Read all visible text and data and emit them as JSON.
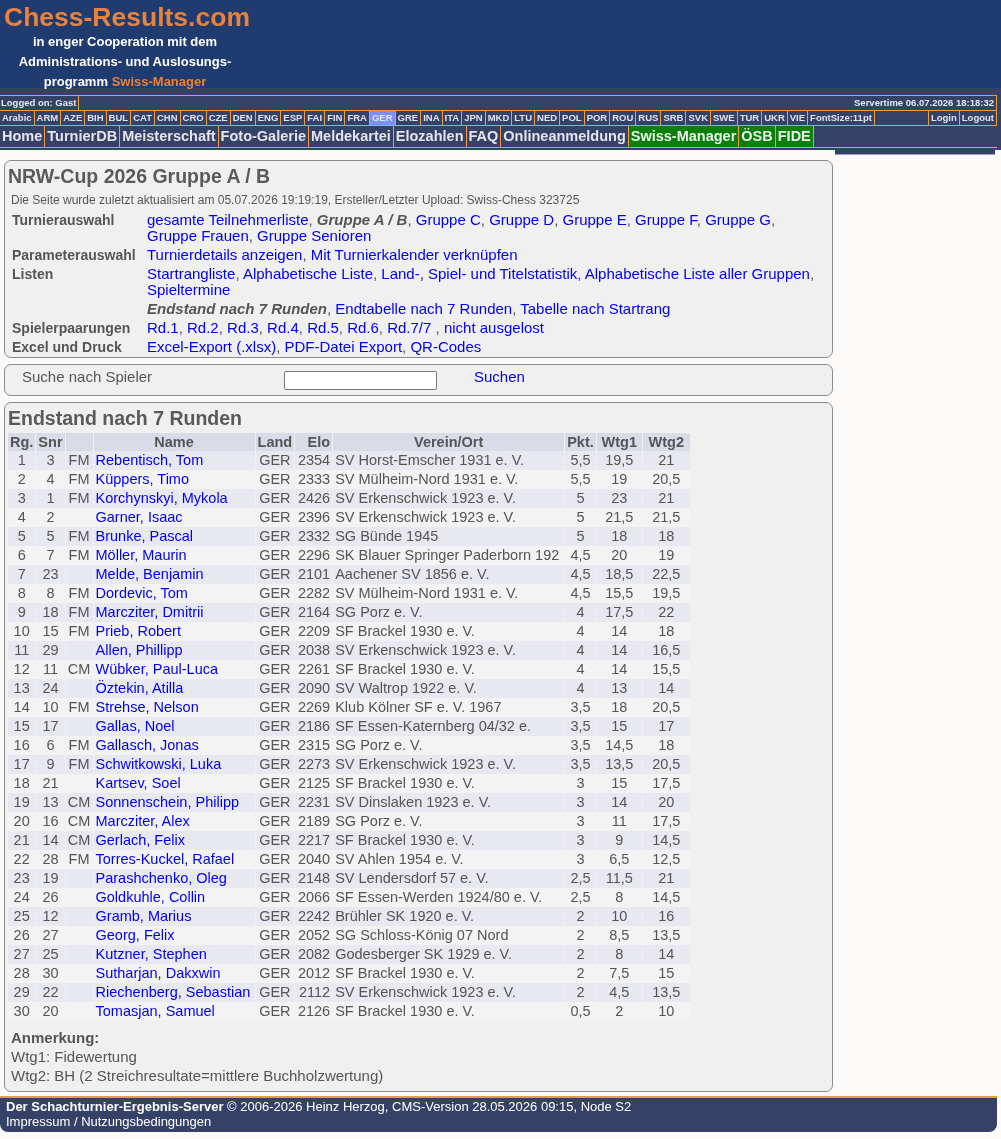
{
  "header": {
    "logo_title": "Chess-Results.com",
    "logo_tagline": [
      "in enger Cooperation mit dem",
      "Administrations- und Auslosungs-",
      "programm"
    ],
    "logo_product": "Swiss-Manager"
  },
  "status_bar": {
    "user": "Logged on: Gast",
    "servertime": "Servertime 06.07.2026 18:18:32"
  },
  "languages": [
    {
      "label": "Arabic",
      "selected": false
    },
    {
      "label": "ARM",
      "selected": false
    },
    {
      "label": "AZE",
      "selected": false
    },
    {
      "label": "BIH",
      "selected": false
    },
    {
      "label": "BUL",
      "selected": false
    },
    {
      "label": "CAT",
      "selected": false
    },
    {
      "label": "CHN",
      "selected": false
    },
    {
      "label": "CRO",
      "selected": false
    },
    {
      "label": "CZE",
      "selected": false
    },
    {
      "label": "DEN",
      "selected": false
    },
    {
      "label": "ENG",
      "selected": false
    },
    {
      "label": "ESP",
      "selected": false
    },
    {
      "label": "FAI",
      "selected": false
    },
    {
      "label": "FIN",
      "selected": false
    },
    {
      "label": "FRA",
      "selected": false
    },
    {
      "label": "GER",
      "selected": true
    },
    {
      "label": "GRE",
      "selected": false
    },
    {
      "label": "INA",
      "selected": false
    },
    {
      "label": "ITA",
      "selected": false
    },
    {
      "label": "JPN",
      "selected": false
    },
    {
      "label": "MKD",
      "selected": false
    },
    {
      "label": "LTU",
      "selected": false
    },
    {
      "label": "NED",
      "selected": false
    },
    {
      "label": "POL",
      "selected": false
    },
    {
      "label": "POR",
      "selected": false
    },
    {
      "label": "ROU",
      "selected": false
    },
    {
      "label": "RUS",
      "selected": false
    },
    {
      "label": "SRB",
      "selected": false
    },
    {
      "label": "SVK",
      "selected": false
    },
    {
      "label": "SWE",
      "selected": false
    },
    {
      "label": "TUR",
      "selected": false
    },
    {
      "label": "UKR",
      "selected": false
    },
    {
      "label": "VIE",
      "selected": false
    }
  ],
  "font_size": "FontSize:11pt",
  "account_links": [
    "Login",
    "Logout"
  ],
  "menu": [
    {
      "label": "Home",
      "kind": "standard"
    },
    {
      "label": "TurnierDB",
      "kind": "standard"
    },
    {
      "label": "Meisterschaft",
      "kind": "standard"
    },
    {
      "label": "Foto-Galerie",
      "kind": "standard"
    },
    {
      "label": "Meldekartei",
      "kind": "standard"
    },
    {
      "label": "Elozahlen",
      "kind": "standard"
    },
    {
      "label": "FAQ",
      "kind": "standard"
    },
    {
      "label": "Onlineanmeldung",
      "kind": "standard"
    },
    {
      "label": "Swiss-Manager",
      "kind": "partner"
    },
    {
      "label": "ÖSB",
      "kind": "partner"
    },
    {
      "label": "FIDE",
      "kind": "partner"
    }
  ],
  "tournament": {
    "title": "NRW-Cup 2026 Gruppe A / B",
    "updated": "Die Seite wurde zuletzt aktualisiert am 05.07.2026 19:19:19, Ersteller/Letzter Upload: Swiss-Chess 323725",
    "rows": [
      {
        "label": "Turnierauswahl",
        "items": [
          {
            "text": "gesamte Teilnehmerliste",
            "kind": "link",
            "after": ", "
          },
          {
            "text": "Gruppe A / B",
            "kind": "current",
            "after": ", "
          },
          {
            "text": "Gruppe C",
            "kind": "link",
            "after": ", "
          },
          {
            "text": "Gruppe D",
            "kind": "link",
            "after": ", "
          },
          {
            "text": "Gruppe E",
            "kind": "link",
            "after": ", "
          },
          {
            "text": "Gruppe F",
            "kind": "link",
            "after": ", "
          },
          {
            "text": "Gruppe G",
            "kind": "link",
            "after": ", "
          },
          {
            "text": "Gruppe Frauen",
            "kind": "link",
            "after": ", "
          },
          {
            "text": "Gruppe Senioren",
            "kind": "link"
          }
        ]
      },
      {
        "label": "Parameterauswahl",
        "items": [
          {
            "text": "Turnierdetails anzeigen",
            "kind": "link",
            "after": ", "
          },
          {
            "text": "Mit Turnierkalender verknüpfen",
            "kind": "link"
          }
        ]
      },
      {
        "label": "Listen",
        "items": [
          {
            "text": "Startrangliste",
            "kind": "link",
            "after": ", "
          },
          {
            "text": "Alphabetische Liste",
            "kind": "link",
            "after": ", "
          },
          {
            "text": "Land-, Spiel- und Titelstatistik",
            "kind": "link",
            "after": ", "
          },
          {
            "text": "Alphabetische Liste aller Gruppen",
            "kind": "link",
            "after": ", "
          },
          {
            "text": "Spieltermine",
            "kind": "link"
          }
        ]
      },
      {
        "items": [
          {
            "text": "Endstand nach 7 Runden",
            "kind": "current",
            "after": ", "
          },
          {
            "text": "Endtabelle nach 7 Runden",
            "kind": "link",
            "after": ", "
          },
          {
            "text": "Tabelle nach Startrang",
            "kind": "link"
          }
        ]
      },
      {
        "label": "Spielerpaarungen",
        "items": [
          {
            "text": "Rd.1",
            "kind": "link",
            "after": ", "
          },
          {
            "text": "Rd.2",
            "kind": "link",
            "after": ", "
          },
          {
            "text": "Rd.3",
            "kind": "link",
            "after": ", "
          },
          {
            "text": "Rd.4",
            "kind": "link",
            "after": ", "
          },
          {
            "text": "Rd.5",
            "kind": "link",
            "after": ", "
          },
          {
            "text": "Rd.6",
            "kind": "link",
            "after": ", "
          },
          {
            "text": "Rd.7/7",
            "kind": "link",
            "after": " , "
          },
          {
            "text": "nicht ausgelost",
            "kind": "link"
          }
        ]
      },
      {
        "label": "Excel und Druck",
        "items": [
          {
            "text": "Excel-Export (.xlsx)",
            "kind": "link",
            "after": ", "
          },
          {
            "text": "PDF-Datei Export",
            "kind": "link",
            "after": ", "
          },
          {
            "text": "QR-Codes",
            "kind": "link"
          }
        ]
      }
    ]
  },
  "search": {
    "label": "Suche nach Spieler",
    "button": "Suchen"
  },
  "standings": {
    "title": "Endstand nach 7 Runden",
    "columns": [
      {
        "label": "Rg.",
        "kind": "text"
      },
      {
        "label": "Snr",
        "kind": "text"
      },
      {
        "kind": "text"
      },
      {
        "label": "Name",
        "kind": "link"
      },
      {
        "label": "Land",
        "kind": "text"
      },
      {
        "label": "Elo",
        "kind": "text"
      },
      {
        "label": "Verein/Ort",
        "kind": "text"
      },
      {
        "label": "Pkt.",
        "kind": "text"
      },
      {
        "label": "Wtg1",
        "kind": "text"
      },
      {
        "label": "Wtg2",
        "kind": "text"
      }
    ],
    "rows": [
      [
        "1",
        "3",
        "FM",
        "Rebentisch, Tom",
        "GER",
        "2354",
        "SV Horst-Emscher 1931 e. V.",
        "5,5",
        "19,5",
        "21"
      ],
      [
        "2",
        "4",
        "FM",
        "Küppers, Timo",
        "GER",
        "2333",
        "SV Mülheim-Nord 1931 e. V.",
        "5,5",
        "19",
        "20,5"
      ],
      [
        "3",
        "1",
        "FM",
        "Korchynskyi, Mykola",
        "GER",
        "2426",
        "SV Erkenschwick 1923 e. V.",
        "5",
        "23",
        "21"
      ],
      [
        "4",
        "2",
        null,
        "Garner, Isaac",
        "GER",
        "2396",
        "SV Erkenschwick 1923 e. V.",
        "5",
        "21,5",
        "21,5"
      ],
      [
        "5",
        "5",
        "FM",
        "Brunke, Pascal",
        "GER",
        "2332",
        "SG Bünde 1945",
        "5",
        "18",
        "18"
      ],
      [
        "6",
        "7",
        "FM",
        "Möller, Maurin",
        "GER",
        "2296",
        "SK Blauer Springer Paderborn 192",
        "4,5",
        "20",
        "19"
      ],
      [
        "7",
        "23",
        null,
        "Melde, Benjamin",
        "GER",
        "2101",
        "Aachener SV 1856 e. V.",
        "4,5",
        "18,5",
        "22,5"
      ],
      [
        "8",
        "8",
        "FM",
        "Dordevic, Tom",
        "GER",
        "2282",
        "SV Mülheim-Nord 1931 e. V.",
        "4,5",
        "15,5",
        "19,5"
      ],
      [
        "9",
        "18",
        "FM",
        "Marcziter, Dmitrii",
        "GER",
        "2164",
        "SG Porz e. V.",
        "4",
        "17,5",
        "22"
      ],
      [
        "10",
        "15",
        "FM",
        "Prieb, Robert",
        "GER",
        "2209",
        "SF Brackel 1930 e. V.",
        "4",
        "14",
        "18"
      ],
      [
        "11",
        "29",
        null,
        "Allen, Phillipp",
        "GER",
        "2038",
        "SV Erkenschwick 1923 e. V.",
        "4",
        "14",
        "16,5"
      ],
      [
        "12",
        "11",
        "CM",
        "Wübker, Paul-Luca",
        "GER",
        "2261",
        "SF Brackel 1930 e. V.",
        "4",
        "14",
        "15,5"
      ],
      [
        "13",
        "24",
        null,
        "Öztekin, Atilla",
        "GER",
        "2090",
        "SV Waltrop 1922 e. V.",
        "4",
        "13",
        "14"
      ],
      [
        "14",
        "10",
        "FM",
        "Strehse, Nelson",
        "GER",
        "2269",
        "Klub Kölner SF e. V. 1967",
        "3,5",
        "18",
        "20,5"
      ],
      [
        "15",
        "17",
        null,
        "Gallas, Noel",
        "GER",
        "2186",
        "SF Essen-Katernberg 04/32 e.",
        "3,5",
        "15",
        "17"
      ],
      [
        "16",
        "6",
        "FM",
        "Gallasch, Jonas",
        "GER",
        "2315",
        "SG Porz e. V.",
        "3,5",
        "14,5",
        "18"
      ],
      [
        "17",
        "9",
        "FM",
        "Schwitkowski, Luka",
        "GER",
        "2273",
        "SV Erkenschwick 1923 e. V.",
        "3,5",
        "13,5",
        "20,5"
      ],
      [
        "18",
        "21",
        null,
        "Kartsev, Soel",
        "GER",
        "2125",
        "SF Brackel 1930 e. V.",
        "3",
        "15",
        "17,5"
      ],
      [
        "19",
        "13",
        "CM",
        "Sonnenschein, Philipp",
        "GER",
        "2231",
        "SV Dinslaken 1923 e. V.",
        "3",
        "14",
        "20"
      ],
      [
        "20",
        "16",
        "CM",
        "Marcziter, Alex",
        "GER",
        "2189",
        "SG Porz e. V.",
        "3",
        "11",
        "17,5"
      ],
      [
        "21",
        "14",
        "CM",
        "Gerlach, Felix",
        "GER",
        "2217",
        "SF Brackel 1930 e. V.",
        "3",
        "9",
        "14,5"
      ],
      [
        "22",
        "28",
        "FM",
        "Torres-Kuckel, Rafael",
        "GER",
        "2040",
        "SV Ahlen 1954 e. V.",
        "3",
        "6,5",
        "12,5"
      ],
      [
        "23",
        "19",
        null,
        "Parashchenko, Oleg",
        "GER",
        "2148",
        "SV Lendersdorf 57 e. V.",
        "2,5",
        "11,5",
        "21"
      ],
      [
        "24",
        "26",
        null,
        "Goldkuhle, Collin",
        "GER",
        "2066",
        "SF Essen-Werden 1924/80 e. V.",
        "2,5",
        "8",
        "14,5"
      ],
      [
        "25",
        "12",
        null,
        "Gramb, Marius",
        "GER",
        "2242",
        "Brühler SK 1920 e. V.",
        "2",
        "10",
        "16"
      ],
      [
        "26",
        "27",
        null,
        "Georg, Felix",
        "GER",
        "2052",
        "SG Schloss-König 07 Nord",
        "2",
        "8,5",
        "13,5"
      ],
      [
        "27",
        "25",
        null,
        "Kutzner, Stephen",
        "GER",
        "2082",
        "Godesberger SK 1929 e. V.",
        "2",
        "8",
        "14"
      ],
      [
        "28",
        "30",
        null,
        "Sutharjan, Dakxwin",
        "GER",
        "2012",
        "SF Brackel 1930 e. V.",
        "2",
        "7,5",
        "15"
      ],
      [
        "29",
        "22",
        null,
        "Riechenberg, Sebastian",
        "GER",
        "2112",
        "SV Erkenschwick 1923 e. V.",
        "2",
        "4,5",
        "13,5"
      ],
      [
        "30",
        "20",
        null,
        "Tomasjan, Samuel",
        "GER",
        "2126",
        "SF Brackel 1930 e. V.",
        "0,5",
        "2",
        "10"
      ]
    ],
    "notes": {
      "heading": "Anmerkung:",
      "lines": [
        "Wtg1: Fidewertung",
        "Wtg2: BH (2 Streichresultate=mittlere Buchholzwertung)"
      ]
    }
  },
  "footer": {
    "text": "**Der Schachturnier-Ergebnis-Server** © 2006-2026 Heinz Herzog, CMS-Version 28.05.2026 09:15, Node S2",
    "links": [
      {
        "text": "Impressum",
        "after": " / "
      },
      {
        "text": "Nutzungsbedingungen"
      }
    ]
  }
}
